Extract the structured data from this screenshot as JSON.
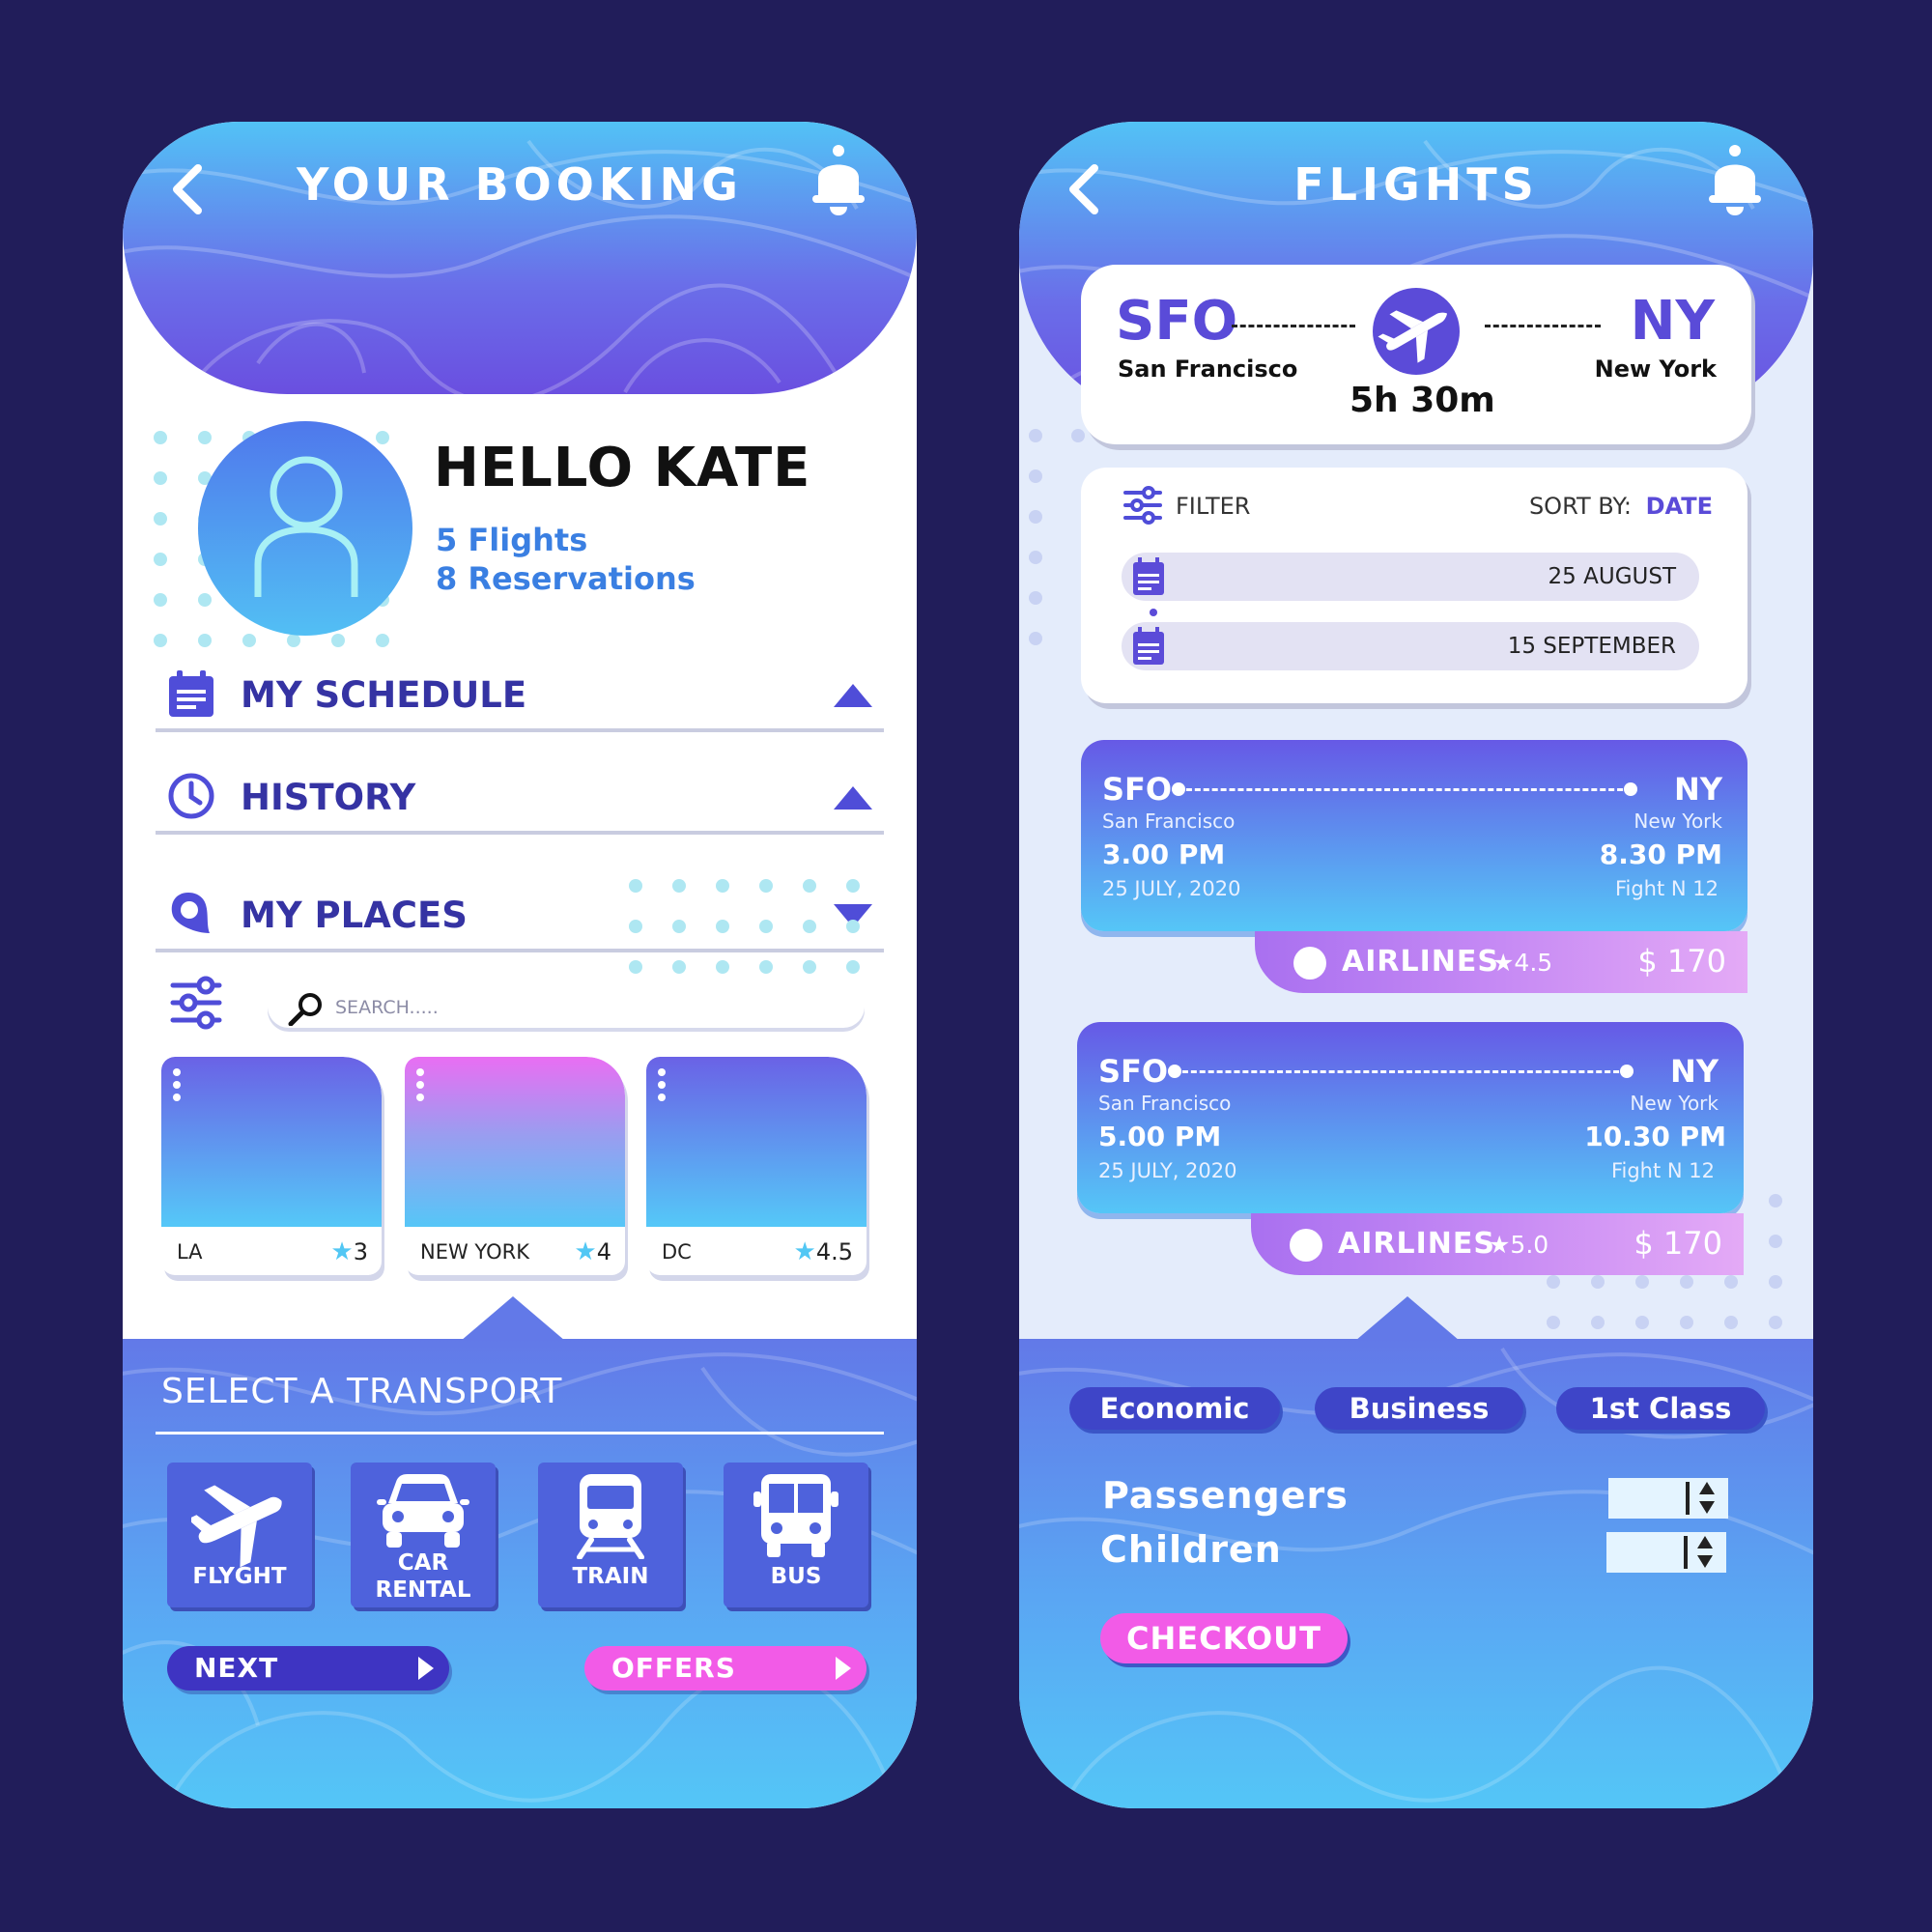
{
  "booking": {
    "title": "YOUR BOOKING",
    "greeting": "HELLO KATE",
    "flights": "5 Flights",
    "reservations": "8 Reservations",
    "sections": [
      {
        "label": "MY SCHEDULE",
        "icon": "calendar-icon",
        "state": "collapsed"
      },
      {
        "label": "HISTORY",
        "icon": "clock-icon",
        "state": "collapsed"
      },
      {
        "label": "MY PLACES",
        "icon": "location-pin-icon",
        "state": "expanded"
      }
    ],
    "search": {
      "placeholder": "SEARCH....."
    },
    "places": [
      {
        "city": "LA",
        "rating": "3"
      },
      {
        "city": "NEW YORK",
        "rating": "4"
      },
      {
        "city": "DC",
        "rating": "4.5"
      }
    ],
    "transport": {
      "title": "SELECT A TRANSPORT",
      "options": [
        {
          "label": "FLYGHT",
          "icon": "airplane-icon"
        },
        {
          "label": "CAR",
          "label2": "RENTAL",
          "icon": "car-icon"
        },
        {
          "label": "TRAIN",
          "icon": "train-icon"
        },
        {
          "label": "BUS",
          "icon": "bus-icon"
        }
      ],
      "next": "NEXT",
      "offers": "OFFERS"
    }
  },
  "flights": {
    "title": "FLIGHTS",
    "route": {
      "from_code": "SFO",
      "from_city": "San Francisco",
      "to_code": "NY",
      "to_city": "New York",
      "duration": "5h 30m"
    },
    "filter": {
      "label": "FILTER",
      "sort_label": "SORT BY:",
      "sort_value": "DATE",
      "date_from": "25 AUGUST",
      "date_to": "15 SEPTEMBER"
    },
    "results": [
      {
        "from_code": "SFO",
        "from_city": "San Francisco",
        "dep_time": "3.00 PM",
        "date": "25 JULY, 2020",
        "to_code": "NY",
        "to_city": "New York",
        "arr_time": "8.30 PM",
        "flight": "Fight N 12",
        "airline": "AIRLINES",
        "rating": "4.5",
        "price": "$ 170"
      },
      {
        "from_code": "SFO",
        "from_city": "San Francisco",
        "dep_time": "5.00 PM",
        "date": "25 JULY, 2020",
        "to_code": "NY",
        "to_city": "New York",
        "arr_time": "10.30 PM",
        "flight": "Fight N 12",
        "airline": "AIRLINES",
        "rating": "5.0",
        "price": "$ 170"
      }
    ],
    "classes": [
      "Economic",
      "Business",
      "1st Class"
    ],
    "passengers_label": "Passengers",
    "children_label": "Children",
    "checkout": "CHECKOUT"
  },
  "tabbar": [
    "search-icon",
    "star-icon",
    "profile-icon"
  ],
  "colors": {
    "background": "#211d5a",
    "accent_purple": "#5a4bd8",
    "accent_blue": "#52c2f6",
    "accent_pink": "#f25be7",
    "heading_navy": "#3533a3"
  }
}
